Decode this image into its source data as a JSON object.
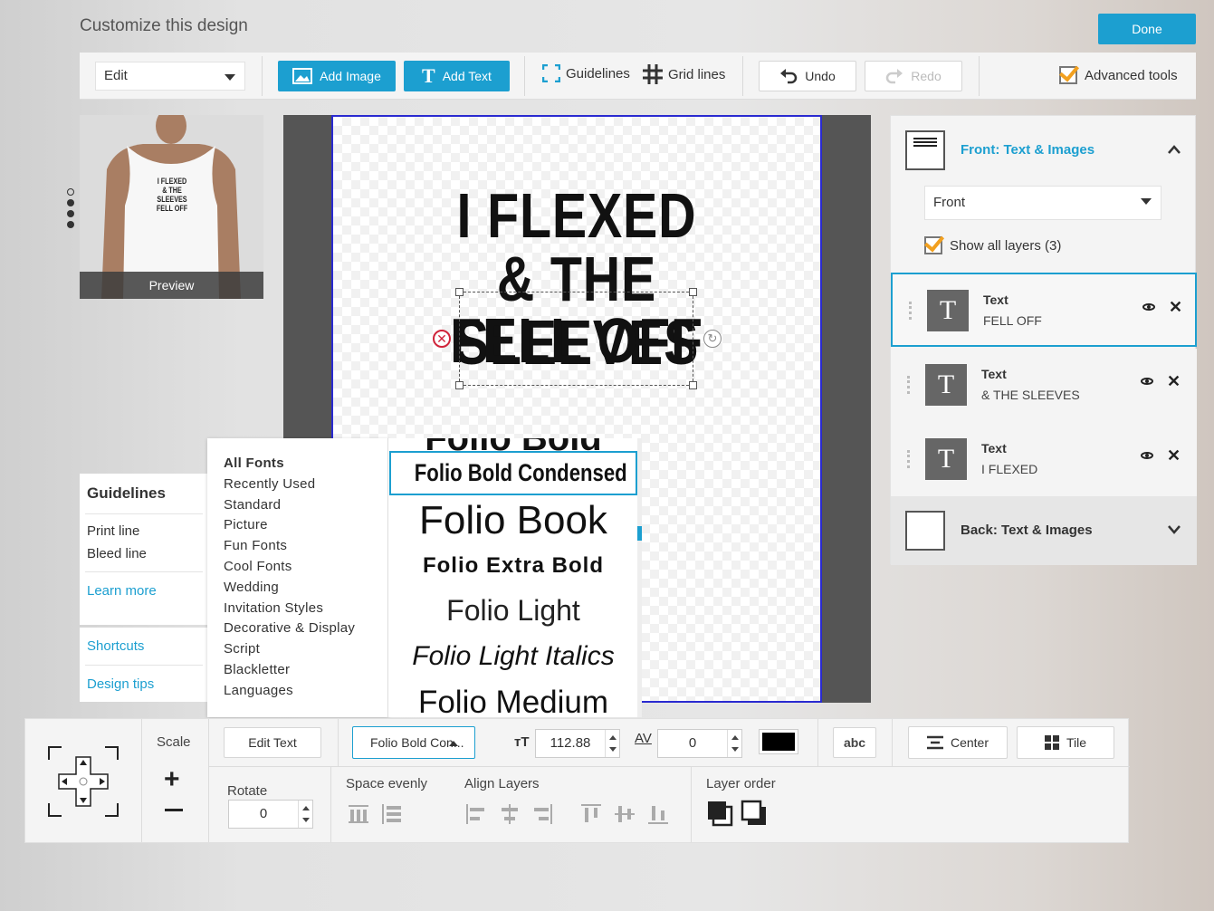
{
  "header": {
    "title": "Customize this design",
    "done_label": "Done"
  },
  "toolbar": {
    "mode_value": "Edit",
    "add_image_label": "Add Image",
    "add_text_label": "Add Text",
    "guidelines_label": "Guidelines",
    "grid_lines_label": "Grid lines",
    "undo_label": "Undo",
    "redo_label": "Redo",
    "advanced_tools_label": "Advanced tools",
    "advanced_tools_checked": true
  },
  "preview": {
    "caption": "Preview",
    "shirt_text": [
      "I FLEXED",
      "& THE SLEEVES",
      "FELL OFF"
    ]
  },
  "design": {
    "lines": [
      "I FLEXED",
      "& THE SLEEVES",
      "FELL OFF"
    ]
  },
  "right_panel": {
    "front_title": "Front: Text & Images",
    "side_value": "Front",
    "show_all_layers_label": "Show all layers (3)",
    "layers": [
      {
        "type": "Text",
        "name": "FELL OFF",
        "active": true
      },
      {
        "type": "Text",
        "name": "& THE SLEEVES",
        "active": false
      },
      {
        "type": "Text",
        "name": "I FLEXED",
        "active": false
      }
    ],
    "back_title": "Back: Text & Images"
  },
  "guidelines_box": {
    "title": "Guidelines",
    "items": [
      "Print line",
      "Bleed line"
    ],
    "learn_more": "Learn more"
  },
  "help_links": {
    "shortcuts": "Shortcuts",
    "design_tips": "Design tips"
  },
  "font_menu": {
    "categories": [
      "All Fonts",
      "Recently Used",
      "Standard",
      "Picture",
      "Fun Fonts",
      "Cool Fonts",
      "Wedding",
      "Invitation Styles",
      "Decorative & Display",
      "Script",
      "Blackletter",
      "Languages"
    ],
    "fonts": [
      "Folio Bold",
      "Folio Bold Condensed",
      "Folio Book",
      "Folio Extra Bold",
      "Folio Light",
      "Folio Light Italics",
      "Folio Medium"
    ],
    "selected_font": "Folio Bold Condensed"
  },
  "bottom_bar": {
    "scale_label": "Scale",
    "edit_text_label": "Edit Text",
    "font_value": "Folio Bold Con...",
    "font_size_value": "112.88",
    "letter_spacing_icon": "AV",
    "letter_spacing_value": "0",
    "color": "#000000",
    "abc_label": "abc",
    "center_label": "Center",
    "tile_label": "Tile",
    "rotate_label": "Rotate",
    "rotate_value": "0",
    "space_evenly_label": "Space evenly",
    "align_layers_label": "Align Layers",
    "layer_order_label": "Layer order"
  },
  "colors": {
    "accent": "#1c9fd0",
    "check": "#f2a01f",
    "canvas_border": "#2a2ad0",
    "delete": "#d0243a"
  }
}
